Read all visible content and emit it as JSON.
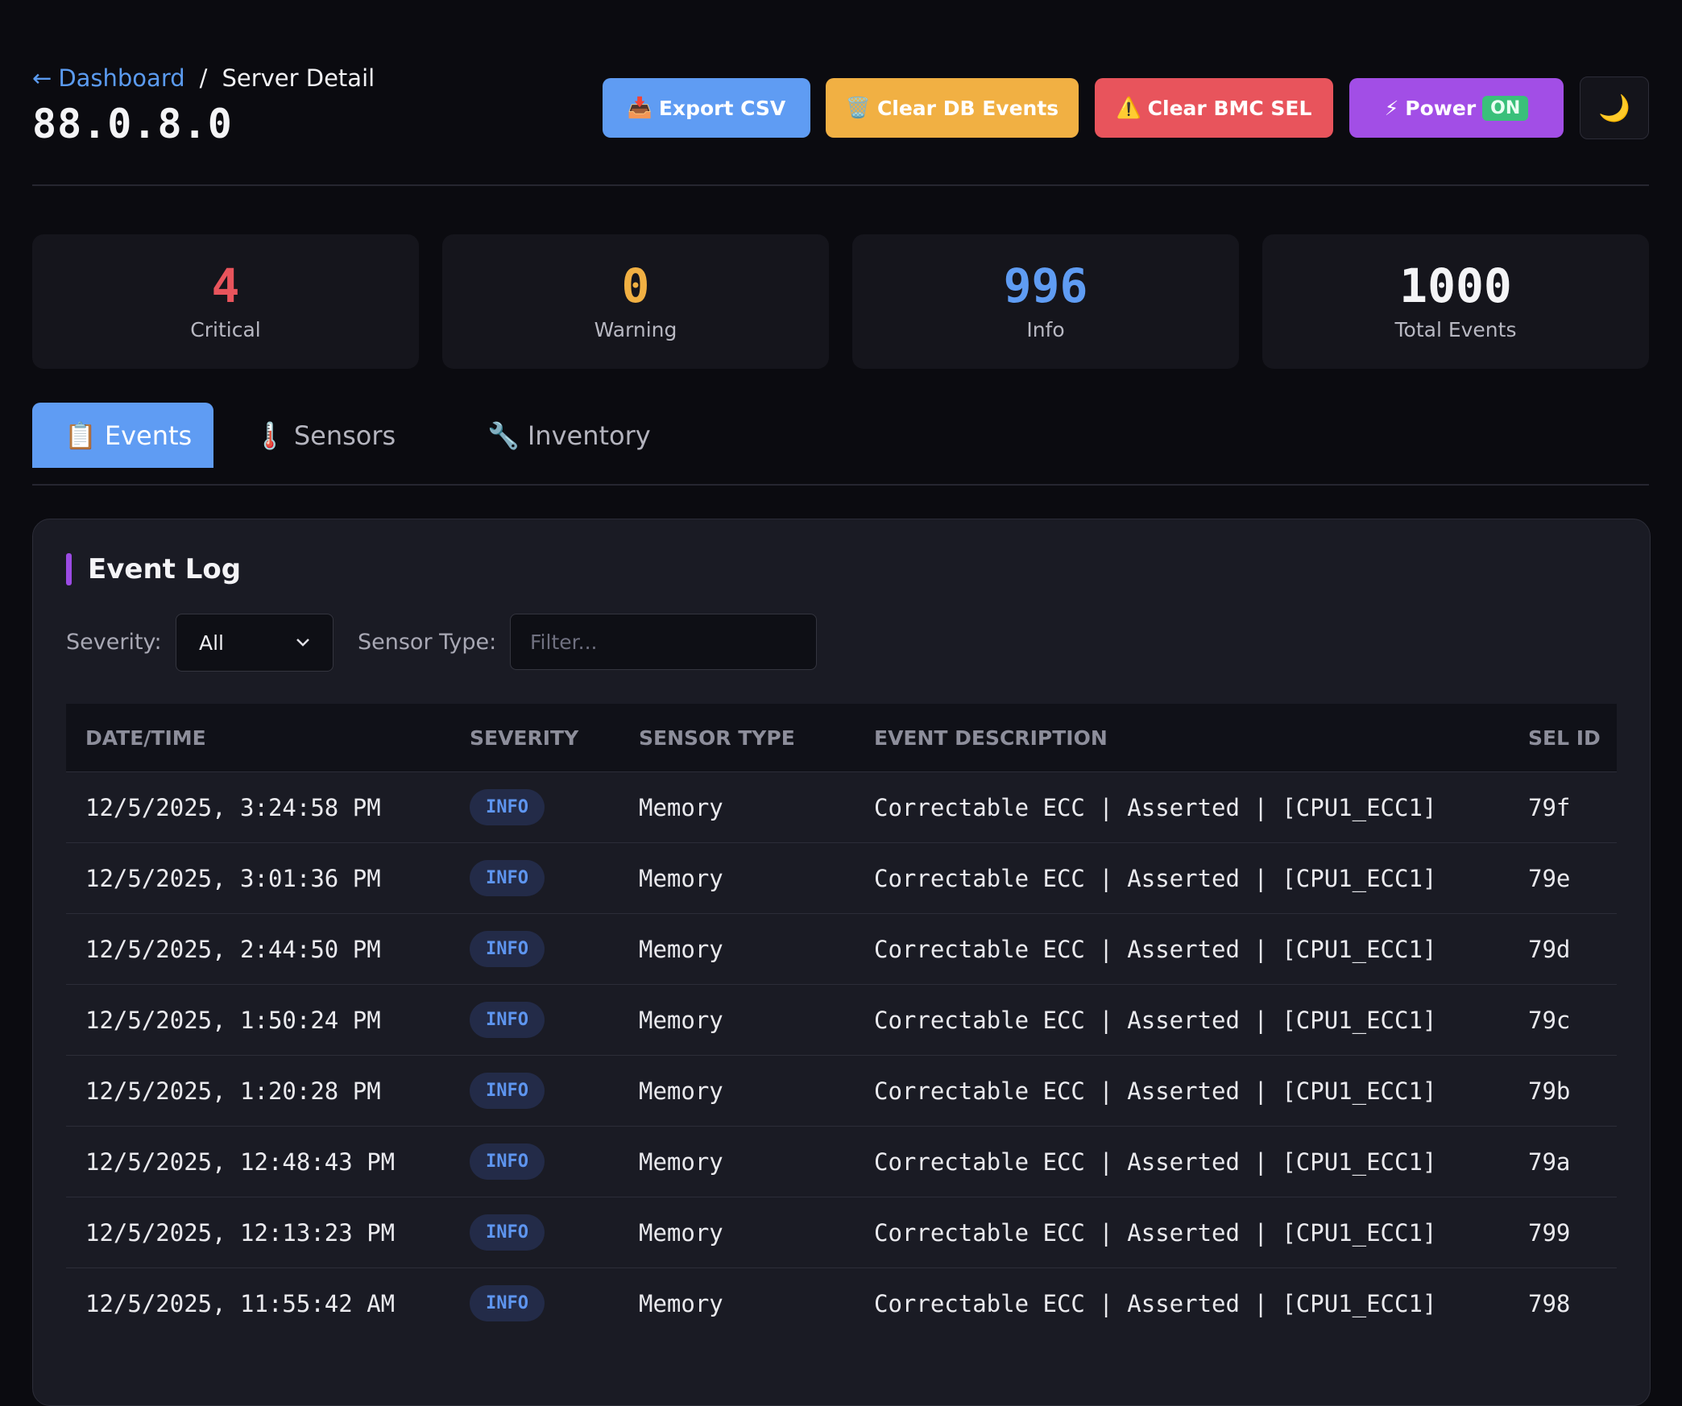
{
  "breadcrumb": {
    "back_arrow": "←",
    "link": "Dashboard",
    "sep": "/",
    "current": "Server Detail"
  },
  "server": {
    "host": "88.0.8.0"
  },
  "actions": {
    "export": {
      "icon": "📥",
      "label": "Export CSV"
    },
    "clear_db": {
      "icon": "🗑️",
      "label": "Clear DB Events"
    },
    "clear_sel": {
      "icon": "⚠️",
      "label": "Clear BMC SEL"
    },
    "power": {
      "icon": "⚡",
      "label": "Power",
      "state": "ON"
    },
    "theme": {
      "icon": "🌙"
    }
  },
  "stats": [
    {
      "value": "4",
      "label": "Critical",
      "color": "#e8545c"
    },
    {
      "value": "0",
      "label": "Warning",
      "color": "#f1b043"
    },
    {
      "value": "996",
      "label": "Info",
      "color": "#5f9cf3"
    },
    {
      "value": "1000",
      "label": "Total Events",
      "color": "#f4f4f6"
    }
  ],
  "tabs": [
    {
      "icon": "📋",
      "label": "Events",
      "active": true
    },
    {
      "icon": "🌡️",
      "label": "Sensors",
      "active": false
    },
    {
      "icon": "🔧",
      "label": "Inventory",
      "active": false
    }
  ],
  "event_log": {
    "title": "Event Log",
    "severity_label": "Severity:",
    "severity_value": "All",
    "sensor_label": "Sensor Type:",
    "sensor_placeholder": "Filter...",
    "columns": [
      "DATE/TIME",
      "SEVERITY",
      "SENSOR TYPE",
      "EVENT DESCRIPTION",
      "SEL ID"
    ],
    "rows": [
      {
        "datetime": "12/5/2025, 3:24:58 PM",
        "severity": "INFO",
        "sensor": "Memory",
        "desc": "Correctable ECC | Asserted | [CPU1_ECC1]",
        "sel": "79f"
      },
      {
        "datetime": "12/5/2025, 3:01:36 PM",
        "severity": "INFO",
        "sensor": "Memory",
        "desc": "Correctable ECC | Asserted | [CPU1_ECC1]",
        "sel": "79e"
      },
      {
        "datetime": "12/5/2025, 2:44:50 PM",
        "severity": "INFO",
        "sensor": "Memory",
        "desc": "Correctable ECC | Asserted | [CPU1_ECC1]",
        "sel": "79d"
      },
      {
        "datetime": "12/5/2025, 1:50:24 PM",
        "severity": "INFO",
        "sensor": "Memory",
        "desc": "Correctable ECC | Asserted | [CPU1_ECC1]",
        "sel": "79c"
      },
      {
        "datetime": "12/5/2025, 1:20:28 PM",
        "severity": "INFO",
        "sensor": "Memory",
        "desc": "Correctable ECC | Asserted | [CPU1_ECC1]",
        "sel": "79b"
      },
      {
        "datetime": "12/5/2025, 12:48:43 PM",
        "severity": "INFO",
        "sensor": "Memory",
        "desc": "Correctable ECC | Asserted | [CPU1_ECC1]",
        "sel": "79a"
      },
      {
        "datetime": "12/5/2025, 12:13:23 PM",
        "severity": "INFO",
        "sensor": "Memory",
        "desc": "Correctable ECC | Asserted | [CPU1_ECC1]",
        "sel": "799"
      },
      {
        "datetime": "12/5/2025, 11:55:42 AM",
        "severity": "INFO",
        "sensor": "Memory",
        "desc": "Correctable ECC | Asserted | [CPU1_ECC1]",
        "sel": "798"
      }
    ]
  }
}
